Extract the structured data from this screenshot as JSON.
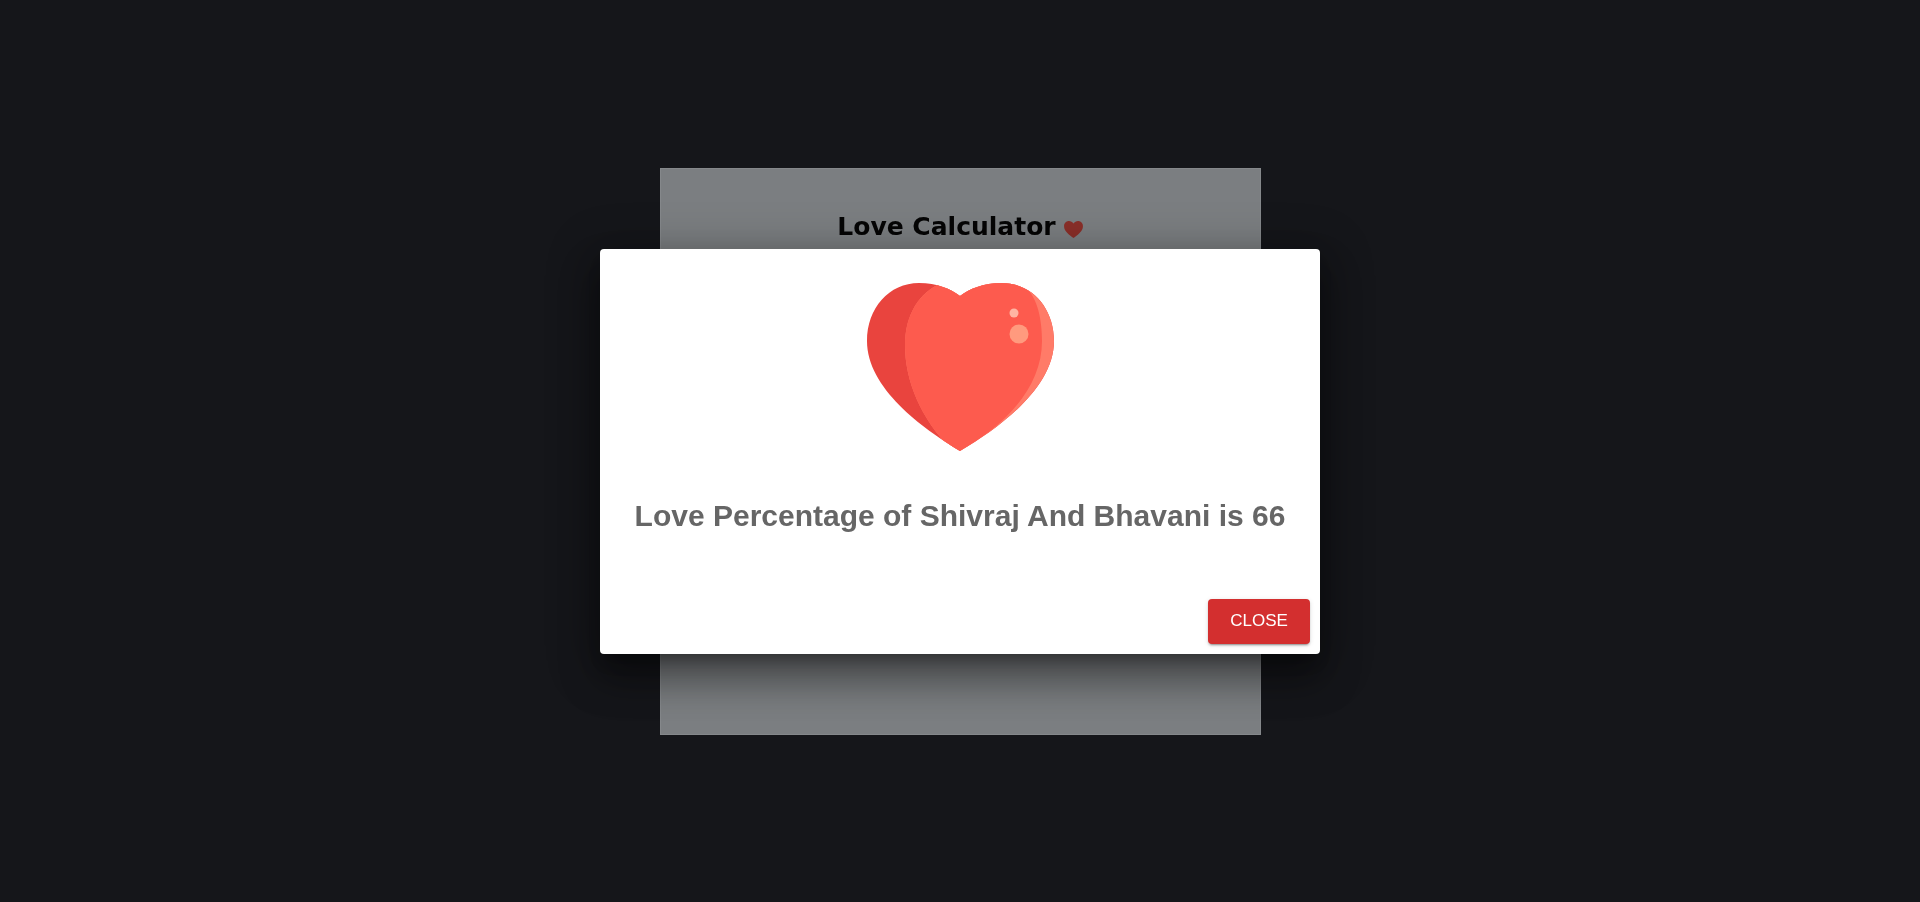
{
  "page": {
    "title": "Love Calculator"
  },
  "dialog": {
    "message": "Love Percentage of Shivraj And Bhavani is 66",
    "close_button": "CLOSE"
  }
}
